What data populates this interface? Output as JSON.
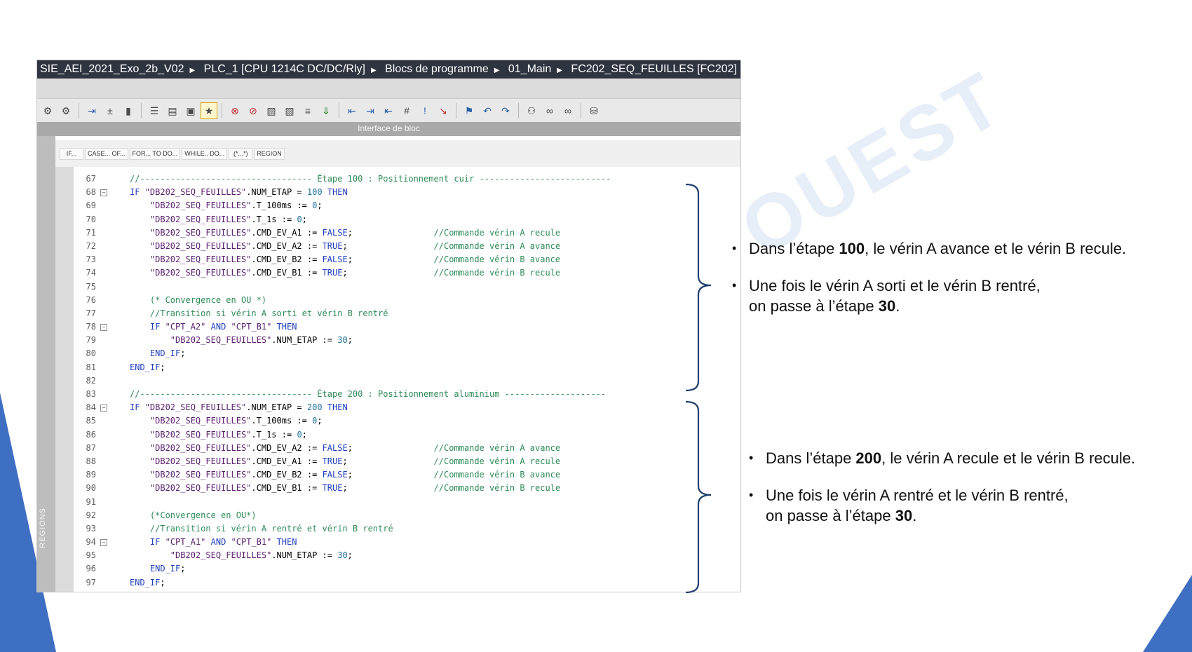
{
  "breadcrumb": [
    "SIE_AEI_2021_Exo_2b_V02",
    "PLC_1 [CPU 1214C DC/DC/Rly]",
    "Blocs de programme",
    "01_Main",
    "FC202_SEQ_FEUILLES [FC202]"
  ],
  "interface_bar": "Interface de bloc",
  "keywords": [
    "IF...",
    "CASE... OF...",
    "FOR... TO DO...",
    "WHILE.. DO...",
    "(*...*)",
    "REGION"
  ],
  "sidebar_label": "REGIONS",
  "watermark": "OUEST",
  "code_lines": [
    {
      "n": "67",
      "fold": "",
      "t": "//---------------------------------- Étape 100 : Positionnement cuir --------------------------"
    },
    {
      "n": "68",
      "fold": "−",
      "t": "IF \"DB202_SEQ_FEUILLES\".NUM_ETAP = 100 THEN"
    },
    {
      "n": "69",
      "fold": "",
      "t": "    \"DB202_SEQ_FEUILLES\".T_100ms := 0;"
    },
    {
      "n": "70",
      "fold": "",
      "t": "    \"DB202_SEQ_FEUILLES\".T_1s := 0;"
    },
    {
      "n": "71",
      "fold": "",
      "t": "    \"DB202_SEQ_FEUILLES\".CMD_EV_A1 := FALSE;                //Commande vérin A recule"
    },
    {
      "n": "72",
      "fold": "",
      "t": "    \"DB202_SEQ_FEUILLES\".CMD_EV_A2 := TRUE;                 //Commande vérin A avance"
    },
    {
      "n": "73",
      "fold": "",
      "t": "    \"DB202_SEQ_FEUILLES\".CMD_EV_B2 := FALSE;                //Commande vérin B avance"
    },
    {
      "n": "74",
      "fold": "",
      "t": "    \"DB202_SEQ_FEUILLES\".CMD_EV_B1 := TRUE;                 //Commande vérin B recule"
    },
    {
      "n": "75",
      "fold": "",
      "t": ""
    },
    {
      "n": "76",
      "fold": "",
      "t": "    (* Convergence en OU *)"
    },
    {
      "n": "77",
      "fold": "",
      "t": "    //Transition si vérin A sorti et vérin B rentré"
    },
    {
      "n": "78",
      "fold": "−",
      "t": "    IF \"CPT_A2\" AND \"CPT_B1\" THEN"
    },
    {
      "n": "79",
      "fold": "",
      "t": "        \"DB202_SEQ_FEUILLES\".NUM_ETAP := 30;"
    },
    {
      "n": "80",
      "fold": "",
      "t": "    END_IF;"
    },
    {
      "n": "81",
      "fold": "",
      "t": "END_IF;"
    },
    {
      "n": "82",
      "fold": "",
      "t": ""
    },
    {
      "n": "83",
      "fold": "",
      "t": "//---------------------------------- Étape 200 : Positionnement aluminium --------------------"
    },
    {
      "n": "84",
      "fold": "−",
      "t": "IF \"DB202_SEQ_FEUILLES\".NUM_ETAP = 200 THEN"
    },
    {
      "n": "85",
      "fold": "",
      "t": "    \"DB202_SEQ_FEUILLES\".T_100ms := 0;"
    },
    {
      "n": "86",
      "fold": "",
      "t": "    \"DB202_SEQ_FEUILLES\".T_1s := 0;"
    },
    {
      "n": "87",
      "fold": "",
      "t": "    \"DB202_SEQ_FEUILLES\".CMD_EV_A2 := FALSE;                //Commande vérin A avance"
    },
    {
      "n": "88",
      "fold": "",
      "t": "    \"DB202_SEQ_FEUILLES\".CMD_EV_A1 := TRUE;                 //Commande vérin A recule"
    },
    {
      "n": "89",
      "fold": "",
      "t": "    \"DB202_SEQ_FEUILLES\".CMD_EV_B2 := FALSE;                //Commande vérin B avance"
    },
    {
      "n": "90",
      "fold": "",
      "t": "    \"DB202_SEQ_FEUILLES\".CMD_EV_B1 := TRUE;                 //Commande vérin B recule"
    },
    {
      "n": "91",
      "fold": "",
      "t": ""
    },
    {
      "n": "92",
      "fold": "",
      "t": "    (*Convergence en OU*)"
    },
    {
      "n": "93",
      "fold": "",
      "t": "    //Transition si vérin A rentré et vérin B rentré"
    },
    {
      "n": "94",
      "fold": "−",
      "t": "    IF \"CPT_A1\" AND \"CPT_B1\" THEN"
    },
    {
      "n": "95",
      "fold": "",
      "t": "        \"DB202_SEQ_FEUILLES\".NUM_ETAP := 30;"
    },
    {
      "n": "96",
      "fold": "",
      "t": "    END_IF;"
    },
    {
      "n": "97",
      "fold": "",
      "t": "END_IF;"
    }
  ],
  "notes_top": {
    "b1": {
      "pre": "Dans l’étape ",
      "num": "100",
      "post": ", le vérin A avance et le vérin B recule."
    },
    "b2": {
      "pre": "Une fois le vérin A sorti et le vérin B rentré,",
      "pre2": "on passe à l’étape ",
      "num": "30",
      "post": "."
    }
  },
  "notes_bottom": {
    "b1": {
      "pre": "Dans l’étape ",
      "num": "200",
      "post": ", le vérin A recule et le vérin B recule."
    },
    "b2": {
      "pre": "Une fois le vérin A rentré et le vérin B rentré,",
      "pre2": "on passe à l’étape ",
      "num": "30",
      "post": "."
    }
  },
  "colors": {
    "accent": "#2f5fa7",
    "bracket": "#1d3f6e",
    "comment": "#2e8b57",
    "keyword": "#1f3fbf"
  }
}
